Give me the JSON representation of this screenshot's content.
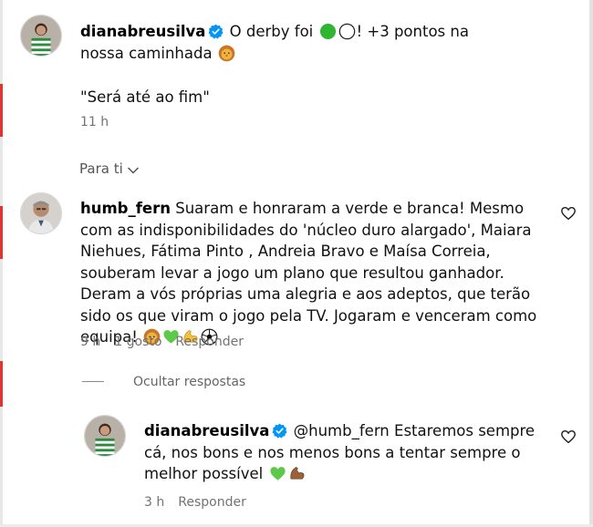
{
  "post": {
    "username": "dianabreusilva",
    "text_part1": "O derby foi",
    "text_part2": "! +3 pontos na nossa caminhada",
    "quote": "\"Será até ao fim\"",
    "time": "11 h"
  },
  "sort": {
    "label": "Para ti"
  },
  "comment": {
    "username": "humb_fern",
    "text": "Suaram e honraram a verde e branca! Mesmo com as indisponibilidades do 'núcleo duro alargado', Maiara Niehues, Fátima Pinto , Andreia Bravo e Maísa Correia, souberam levar a jogo um plano que resultou ganhador. Deram a vós próprias uma alegria e aos adeptos, que terão sido os que viram o jogo pela TV. Jogaram e venceram como equipa!",
    "time": "9 h",
    "likes": "1 gosto",
    "reply_label": "Responder"
  },
  "hide_replies": {
    "label": "Ocultar respostas"
  },
  "reply": {
    "username": "dianabreusilva",
    "mention": "@humb_fern",
    "text": "Estaremos sempre cá, nos bons e nos menos bons a tentar sempre o melhor possível",
    "time": "3 h",
    "reply_label": "Responder"
  },
  "colors": {
    "verified_blue": "#0095f6",
    "sporting_green": "#2fb52f",
    "heart_green": "#5dc94a",
    "meta_gray": "#737373",
    "red_mark": "#e5322d"
  },
  "icons": [
    "verified-badge-icon",
    "green-circle-icon",
    "white-circle-icon",
    "lion-face-icon",
    "green-heart-icon",
    "flexed-biceps-icon",
    "soccer-ball-icon",
    "heart-outline-icon",
    "chevron-down-icon"
  ]
}
